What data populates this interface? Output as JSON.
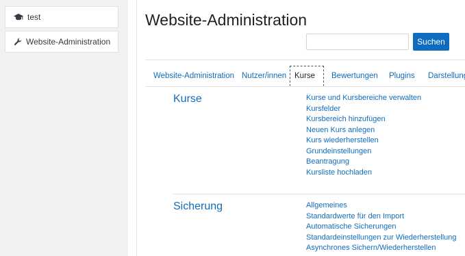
{
  "sidebar": {
    "items": [
      {
        "label": "test",
        "icon": "graduation-cap-icon"
      },
      {
        "label": "Website-Administration",
        "icon": "wrench-icon"
      }
    ]
  },
  "header": {
    "title": "Website-Administration"
  },
  "search": {
    "value": "",
    "button_label": "Suchen"
  },
  "tabs": [
    {
      "label": "Website-Administration",
      "active": false
    },
    {
      "label": "Nutzer/innen",
      "active": false
    },
    {
      "label": "Kurse",
      "active": true
    },
    {
      "label": "Bewertungen",
      "active": false
    },
    {
      "label": "Plugins",
      "active": false
    },
    {
      "label": "Darstellung",
      "active": false
    }
  ],
  "sections": [
    {
      "title": "Kurse",
      "links": [
        "Kurse und Kursbereiche verwalten",
        "Kursfelder",
        "Kursbereich hinzufügen",
        "Neuen Kurs anlegen",
        "Kurs wiederherstellen",
        "Grundeinstellungen",
        "Beantragung",
        "Kursliste hochladen"
      ]
    },
    {
      "title": "Sicherung",
      "links": [
        "Allgemeines",
        "Standardwerte für den Import",
        "Automatische Sicherungen",
        "Standardeinstellungen zur Wiederherstellung",
        "Asynchrones Sichern/Wiederherstellen"
      ]
    }
  ],
  "colors": {
    "accent": "#0f6cbf",
    "sidebar_bg": "#f2f2f2",
    "text": "#1d2125"
  }
}
